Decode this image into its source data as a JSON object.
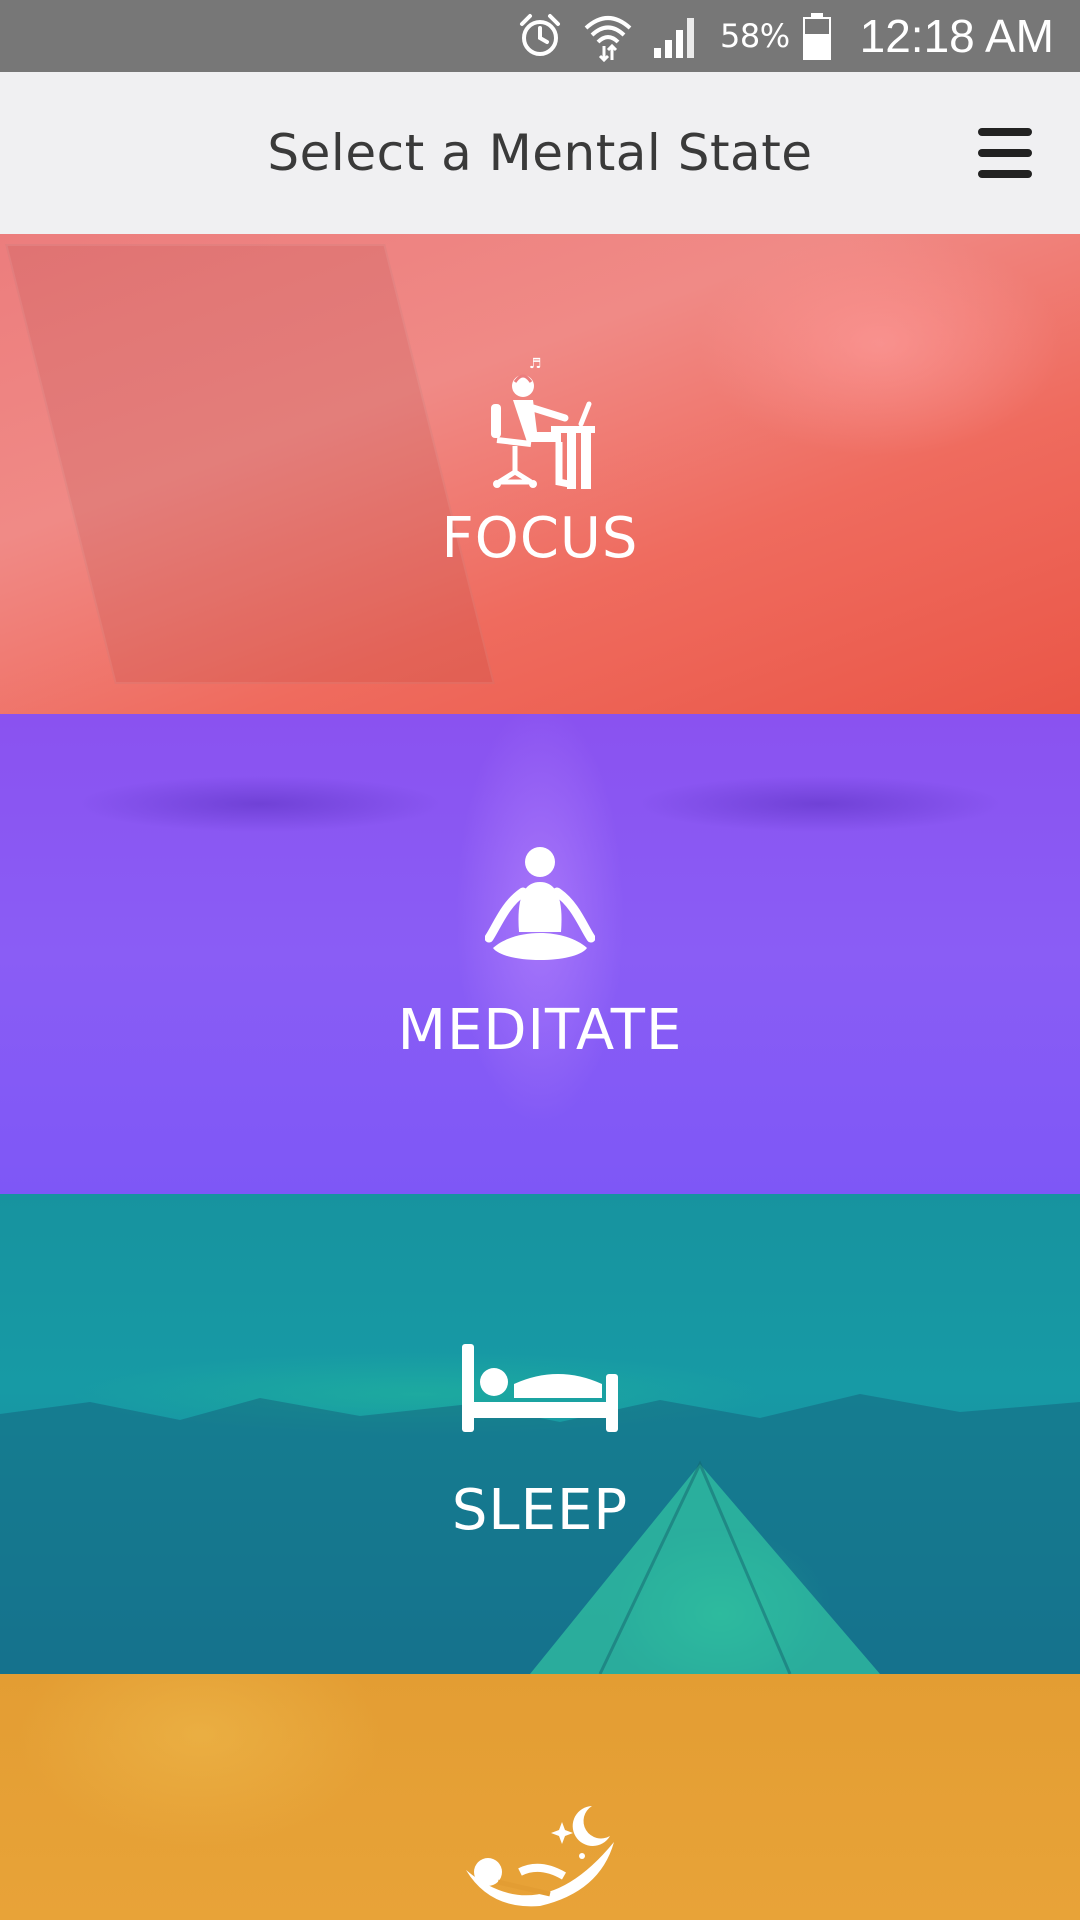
{
  "status_bar": {
    "battery_percent": "58%",
    "time": "12:18 AM",
    "icons": [
      "alarm-icon",
      "wifi-icon",
      "signal-icon",
      "battery-icon"
    ]
  },
  "header": {
    "title": "Select a Mental State",
    "menu_icon": "hamburger-menu-icon"
  },
  "tiles": [
    {
      "label": "FOCUS",
      "icon": "focus-desk-icon",
      "color": "#ef6b5e"
    },
    {
      "label": "MEDITATE",
      "icon": "meditation-pose-icon",
      "color": "#8a5df5"
    },
    {
      "label": "SLEEP",
      "icon": "bed-icon",
      "color": "#179aa5"
    },
    {
      "label": "",
      "icon": "hammock-nap-icon",
      "color": "#e39d33"
    }
  ]
}
